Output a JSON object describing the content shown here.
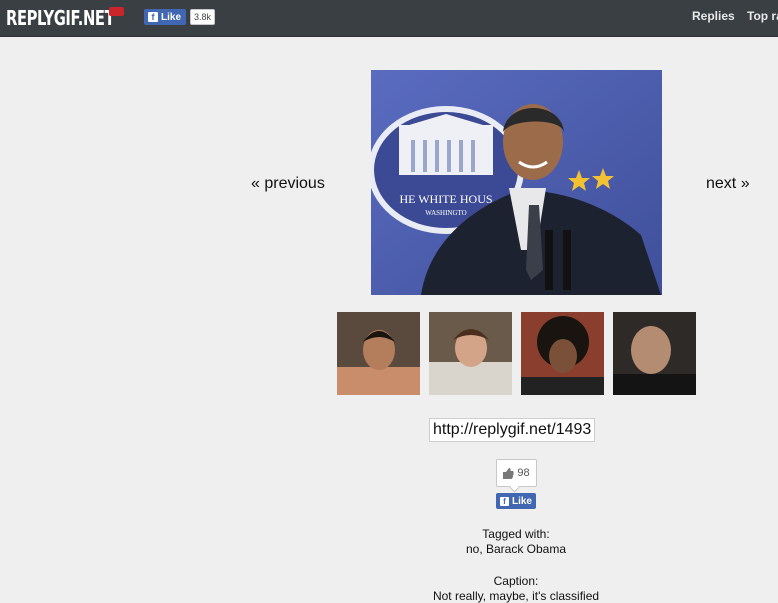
{
  "header": {
    "logo": "REPLYGIF.NET",
    "fb_like_label": "Like",
    "fb_like_count": "3.8k",
    "nav": [
      "Replies",
      "Top ra"
    ]
  },
  "pager": {
    "previous": "« previous",
    "next": "next »"
  },
  "main_gif": {
    "podium_text": "HE WHITE HOUS",
    "podium_subtext": "WASHINGTO"
  },
  "thumbnails_count": 4,
  "url": "http://replygif.net/1493",
  "likes": {
    "count": "98",
    "label": "Like"
  },
  "tags": {
    "heading": "Tagged with:",
    "value": "no, Barack Obama"
  },
  "caption": {
    "heading": "Caption:",
    "value": "Not really, maybe, it's classified"
  },
  "colors": {
    "topbar": "#3a3f44",
    "facebook": "#4267b2",
    "logo_mark": "#c9252b"
  }
}
